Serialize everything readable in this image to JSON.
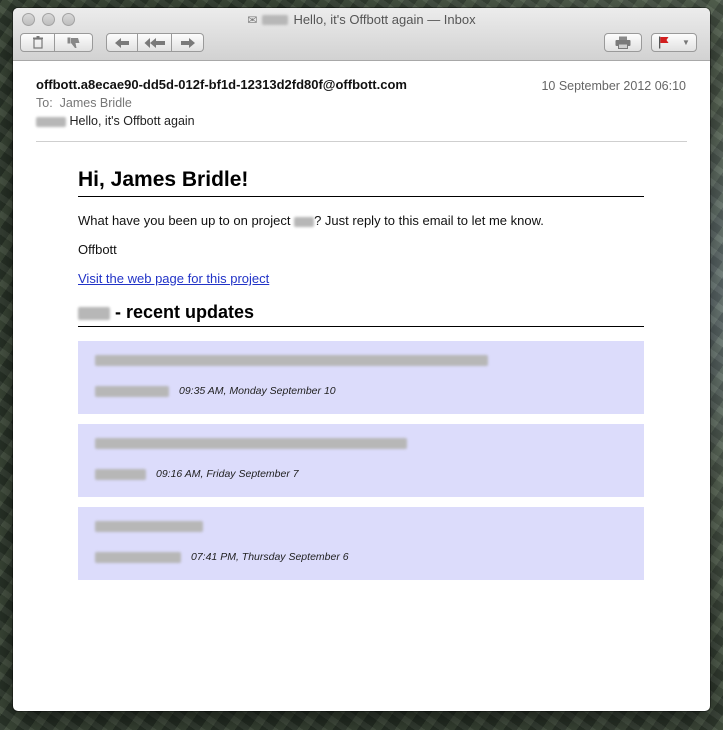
{
  "window": {
    "title": "Hello, it's Offbott again — Inbox"
  },
  "toolbar": {
    "delete_icon": "trash-icon",
    "junk_icon": "thumbs-down-icon",
    "reply_icon": "reply-icon",
    "reply_all_icon": "reply-all-icon",
    "forward_icon": "forward-icon",
    "print_icon": "printer-icon",
    "flag_icon": "flag-icon"
  },
  "message": {
    "from": "offbott.a8ecae90-dd5d-012f-bf1d-12313d2fd80f@offbott.com",
    "date": "10 September 2012 06:10",
    "to_label": "To:",
    "to_name": "James Bridle",
    "subject": "Hello, it's Offbott again"
  },
  "body": {
    "greeting": "Hi, James Bridle!",
    "question_prefix": "What have you been up to on project ",
    "question_suffix": "? Just reply to this email to let me know.",
    "signature": "Offbott",
    "link_text": "Visit the web page for this project",
    "updates_heading": " - recent updates",
    "updates": [
      {
        "time": "09:35 AM, Monday September 10"
      },
      {
        "time": "09:16 AM, Friday September 7"
      },
      {
        "time": "07:41 PM, Thursday September 6"
      }
    ]
  },
  "colors": {
    "update_bg": "#dcdcfb",
    "link": "#2133c7"
  }
}
